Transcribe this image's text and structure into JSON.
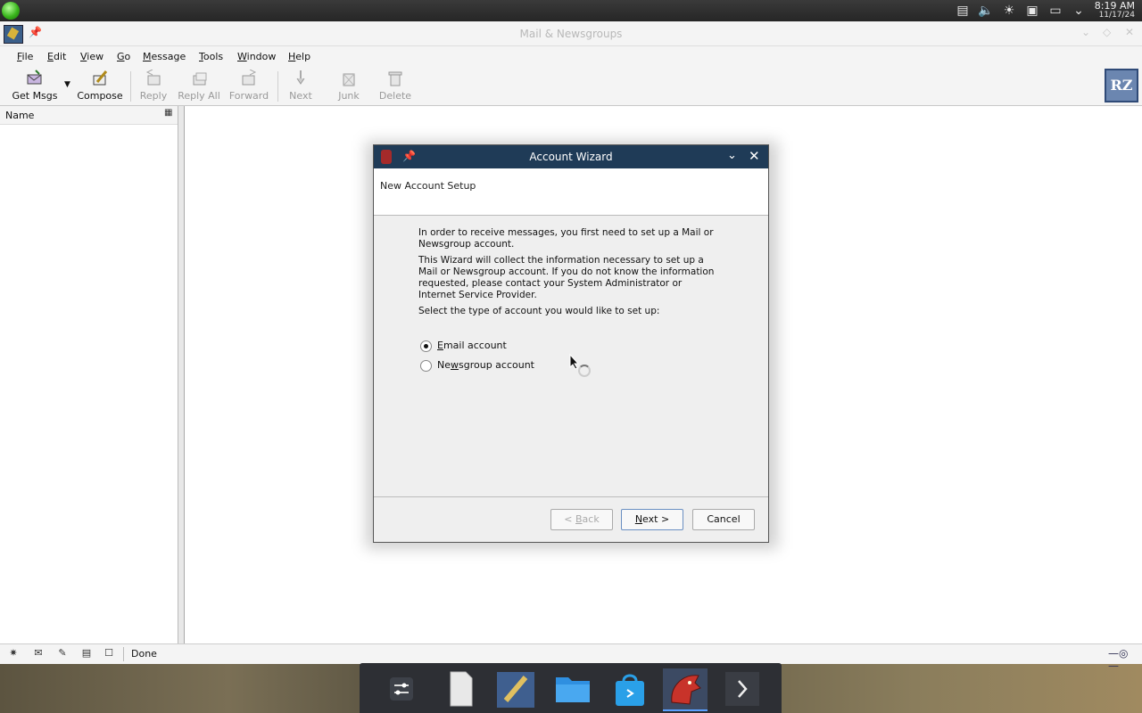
{
  "system": {
    "clock_time": "8:19 AM",
    "clock_date": "11/17/24"
  },
  "window": {
    "title": "Mail & Newsgroups"
  },
  "menu": {
    "items": [
      {
        "pre": "",
        "accel": "F",
        "post": "ile"
      },
      {
        "pre": "",
        "accel": "E",
        "post": "dit"
      },
      {
        "pre": "",
        "accel": "V",
        "post": "iew"
      },
      {
        "pre": "",
        "accel": "G",
        "post": "o"
      },
      {
        "pre": "",
        "accel": "M",
        "post": "essage"
      },
      {
        "pre": "",
        "accel": "T",
        "post": "ools"
      },
      {
        "pre": "",
        "accel": "W",
        "post": "indow"
      },
      {
        "pre": "",
        "accel": "H",
        "post": "elp"
      }
    ]
  },
  "toolbar": {
    "get_msgs": "Get Msgs",
    "compose": "Compose",
    "reply": "Reply",
    "reply_all": "Reply All",
    "forward": "Forward",
    "next": "Next",
    "junk": "Junk",
    "delete": "Delete",
    "logo": "RZ"
  },
  "folder_pane": {
    "column_name": "Name"
  },
  "status": {
    "text": "Done"
  },
  "dialog": {
    "title": "Account Wizard",
    "heading": "New Account Setup",
    "para1": "In order to receive messages, you first need to set up a Mail or Newsgroup account.",
    "para2": "This Wizard will collect the information necessary to set up a Mail or Newsgroup account. If you do not know the information requested, please contact your System Administrator or Internet Service Provider.",
    "para3": "Select the type of account you would like to set up:",
    "option_email": {
      "pre": "",
      "accel": "E",
      "post": "mail account",
      "checked": true
    },
    "option_news": {
      "pre": "Ne",
      "accel": "w",
      "post": "sgroup account",
      "checked": false
    },
    "back": {
      "pre": "< ",
      "accel": "B",
      "post": "ack"
    },
    "next": {
      "pre": "",
      "accel": "N",
      "post": "ext >"
    },
    "cancel": "Cancel"
  }
}
